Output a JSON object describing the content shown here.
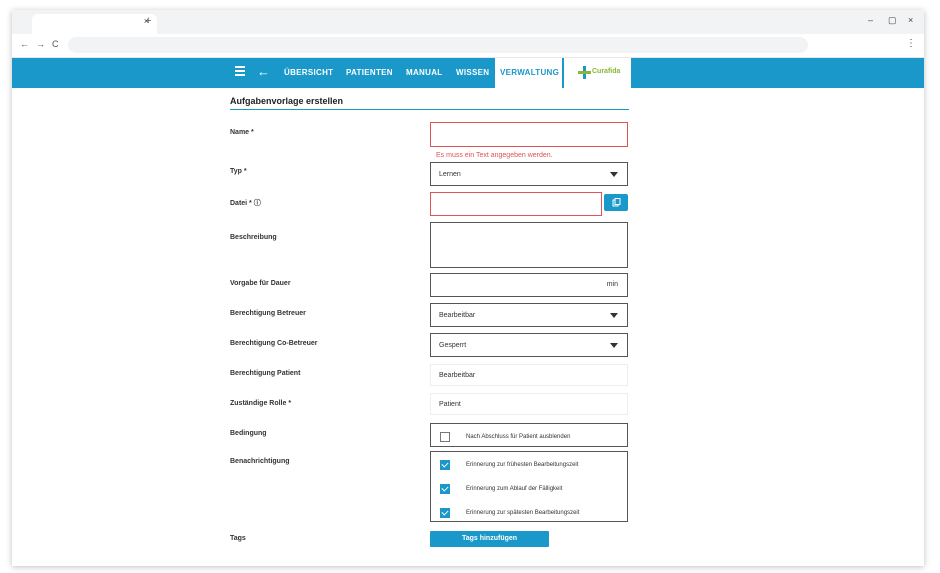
{
  "browser": {
    "tab_close": "×",
    "new_tab": "+",
    "minimize": "–",
    "restore": "▢",
    "close": "×",
    "back": "←",
    "forward": "→",
    "reload": "C",
    "menu": "⋮"
  },
  "nav": {
    "back": "←",
    "items": [
      "ÜBERSICHT",
      "PATIENTEN",
      "MANUAL",
      "WISSEN"
    ],
    "active": "VERWALTUNG",
    "logo": "Curafida"
  },
  "form": {
    "title": "Aufgabenvorlage erstellen",
    "name_label": "Name *",
    "name_error": "Es muss ein Text angegeben werden.",
    "typ_label": "Typ *",
    "typ_value": "Lernen",
    "datei_label": "Datei * ⓘ",
    "beschreibung_label": "Beschreibung",
    "dauer_label": "Vorgabe für Dauer",
    "dauer_unit": "min",
    "betreuer_label": "Berechtigung Betreuer",
    "betreuer_value": "Bearbeitbar",
    "cobetreuer_label": "Berechtigung Co-Betreuer",
    "cobetreuer_value": "Gesperrt",
    "patient_label": "Berechtigung Patient",
    "patient_value": "Bearbeitbar",
    "rolle_label": "Zuständige Rolle *",
    "rolle_value": "Patient",
    "bedingung_label": "Bedingung",
    "bedingung_option": "Nach Abschluss für Patient ausblenden",
    "benachrichtigung_label": "Benachrichtigung",
    "benachrichtigung_options": [
      "Erinnerung zur frühesten Bearbeitungszeit",
      "Erinnerung zum Ablauf der Fälligkeit",
      "Erinnerung zur spätesten Bearbeitungszeit"
    ],
    "tags_label": "Tags",
    "tags_button": "Tags hinzufügen"
  },
  "colors": {
    "brand": "#1998c9",
    "error": "#e05355",
    "logo_green": "#8ab634"
  }
}
